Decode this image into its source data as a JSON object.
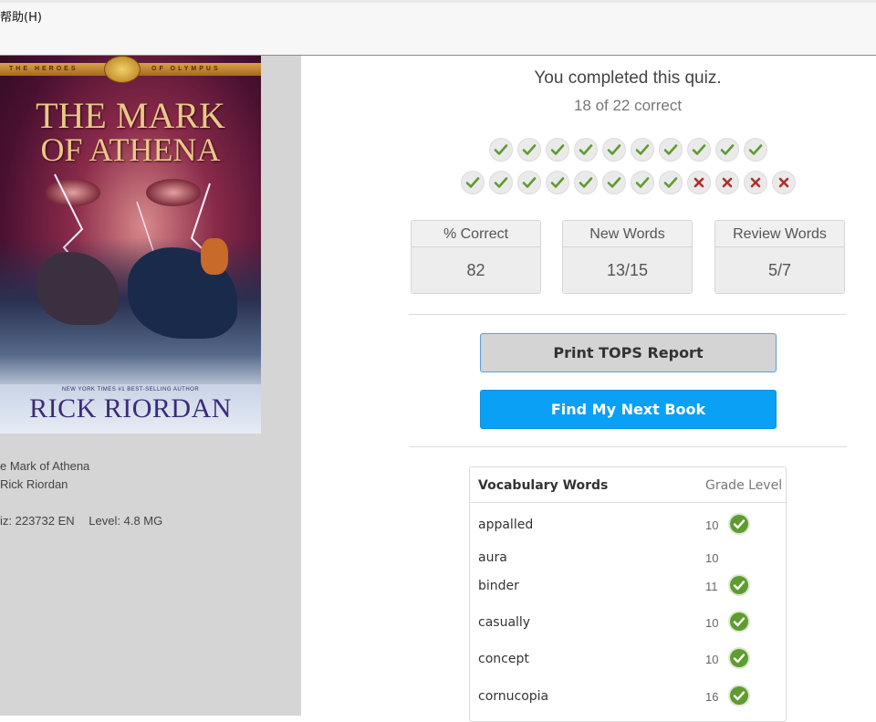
{
  "menu": {
    "help_label": "帮助(H)"
  },
  "book": {
    "cover": {
      "series_left": "THE HEROES",
      "series_right": "OF OLYMPUS",
      "title_line1": "THE MARK",
      "title_line2": "OF ATHENA",
      "bestseller_line": "NEW YORK TIMES #1 BEST-SELLING AUTHOR",
      "author": "RICK RIORDAN"
    },
    "title_text": "e Mark of Athena",
    "author_text": "Rick Riordan",
    "quiz_text": "iz: 223732 EN",
    "level_text": "Level: 4.8 MG"
  },
  "result": {
    "title": "You completed this quiz.",
    "score_text": "18 of 22 correct",
    "marks_row1": [
      "correct",
      "correct",
      "correct",
      "correct",
      "correct",
      "correct",
      "correct",
      "correct",
      "correct",
      "correct"
    ],
    "marks_row2": [
      "correct",
      "correct",
      "correct",
      "correct",
      "correct",
      "correct",
      "correct",
      "correct",
      "wrong",
      "wrong",
      "wrong",
      "wrong"
    ]
  },
  "stats": [
    {
      "label": "% Correct",
      "value": "82"
    },
    {
      "label": "New Words",
      "value": "13/15"
    },
    {
      "label": "Review Words",
      "value": "5/7"
    }
  ],
  "buttons": {
    "print_label": "Print TOPS Report",
    "next_label": "Find My Next Book"
  },
  "vocab": {
    "header_word": "Vocabulary Words",
    "header_grade": "Grade Level",
    "rows": [
      {
        "word": "appalled",
        "grade": "10",
        "mastered": true
      },
      {
        "word": "aura",
        "grade": "10",
        "mastered": false
      },
      {
        "word": "binder",
        "grade": "11",
        "mastered": true
      },
      {
        "word": "casually",
        "grade": "10",
        "mastered": true
      },
      {
        "word": "concept",
        "grade": "10",
        "mastered": true
      },
      {
        "word": "cornucopia",
        "grade": "16",
        "mastered": true
      }
    ]
  },
  "colors": {
    "check_green": "#5f9c2f",
    "wrong_red": "#b0302a",
    "next_button_blue": "#0aa0f5",
    "left_panel_gray": "#d5d5d5"
  },
  "icons": {
    "correct": "check-icon",
    "wrong": "x-icon",
    "mastered": "check-circle-icon"
  }
}
